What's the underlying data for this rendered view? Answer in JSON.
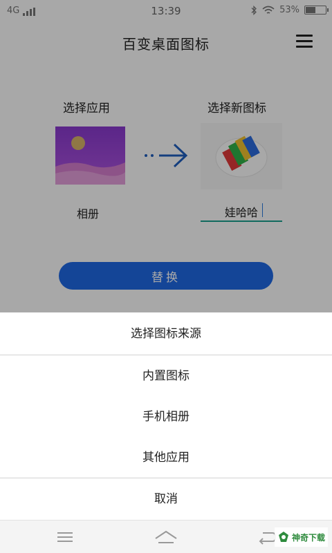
{
  "status_bar": {
    "network": "4G",
    "time": "13:39",
    "battery_text": "53%",
    "battery_level": 0.53
  },
  "header": {
    "title": "百变桌面图标"
  },
  "main": {
    "select_app_label": "选择应用",
    "select_icon_label": "选择新图标",
    "app_name": "相册",
    "new_name_value": "娃哈哈",
    "replace_button": "替换"
  },
  "sheet": {
    "title": "选择图标来源",
    "options": [
      "内置图标",
      "手机相册",
      "其他应用"
    ],
    "cancel": "取消"
  },
  "watermark": {
    "text": "神奇下载"
  },
  "colors": {
    "accent": "#1f6ae6",
    "input_underline": "#1aa28f",
    "gallery_purple": "#8e3fd6"
  }
}
